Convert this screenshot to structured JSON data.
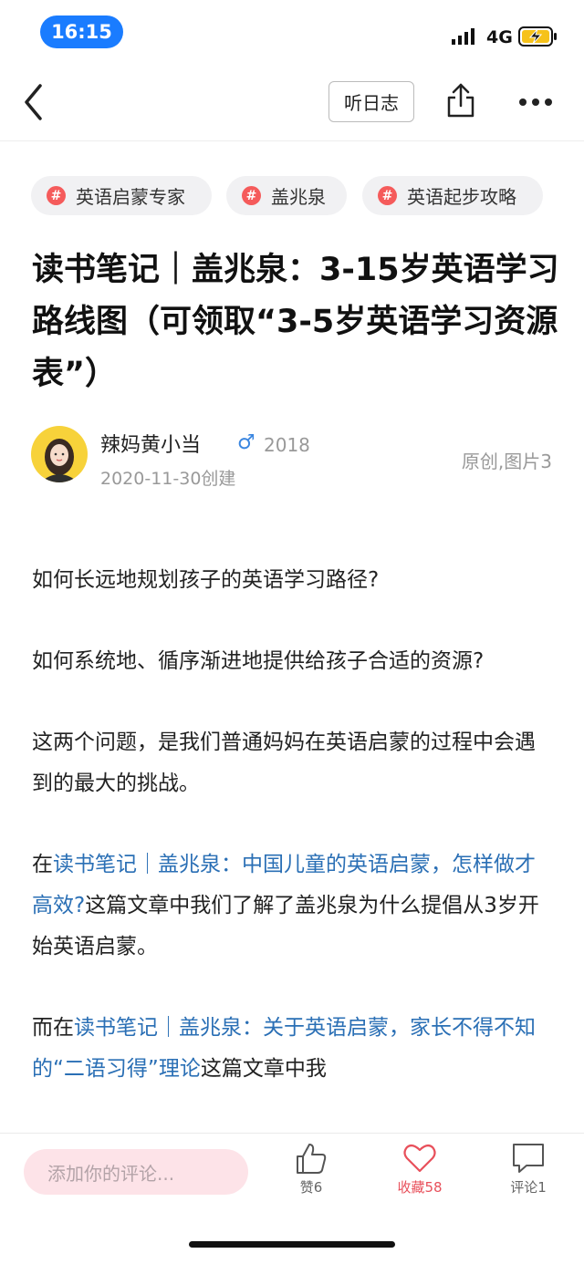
{
  "status_bar": {
    "time": "16:15",
    "network": "4G"
  },
  "nav": {
    "listen_label": "听日志"
  },
  "tags": [
    "英语启蒙专家",
    "盖兆泉",
    "英语起步攻略"
  ],
  "article": {
    "title": "读书笔记｜盖兆泉：3-15岁英语学习路线图（可领取“3-5岁英语学习资源表”）",
    "author": "辣妈黄小当",
    "gender_symbol": "♂",
    "join_year": "2018",
    "created": "2020-11-30创建",
    "meta_right": "原创,图片3",
    "paragraphs": [
      {
        "text": "如何长远地规划孩子的英语学习路径?"
      },
      {
        "text": "如何系统地、循序渐进地提供给孩子合适的资源?"
      },
      {
        "text": "这两个问题，是我们普通妈妈在英语启蒙的过程中会遇到的最大的挑战。"
      },
      {
        "prefix": "在",
        "link": "读书笔记｜盖兆泉：中国儿童的英语启蒙，怎样做才高效?",
        "suffix": "这篇文章中我们了解了盖兆泉为什么提倡从3岁开始英语启蒙。"
      },
      {
        "prefix": "而在",
        "link": "读书笔记｜盖兆泉：关于英语启蒙，家长不得不知的“二语习得”理论",
        "suffix": "这篇文章中我"
      }
    ]
  },
  "bottom_bar": {
    "comment_placeholder": "添加你的评论...",
    "like_label": "赞6",
    "collect_label": "收藏58",
    "comment_label": "评论1"
  },
  "colors": {
    "accent": "#1a7cff",
    "tag_hash": "#f55b5b",
    "link": "#2a6fb5",
    "collect": "#e8505b"
  }
}
